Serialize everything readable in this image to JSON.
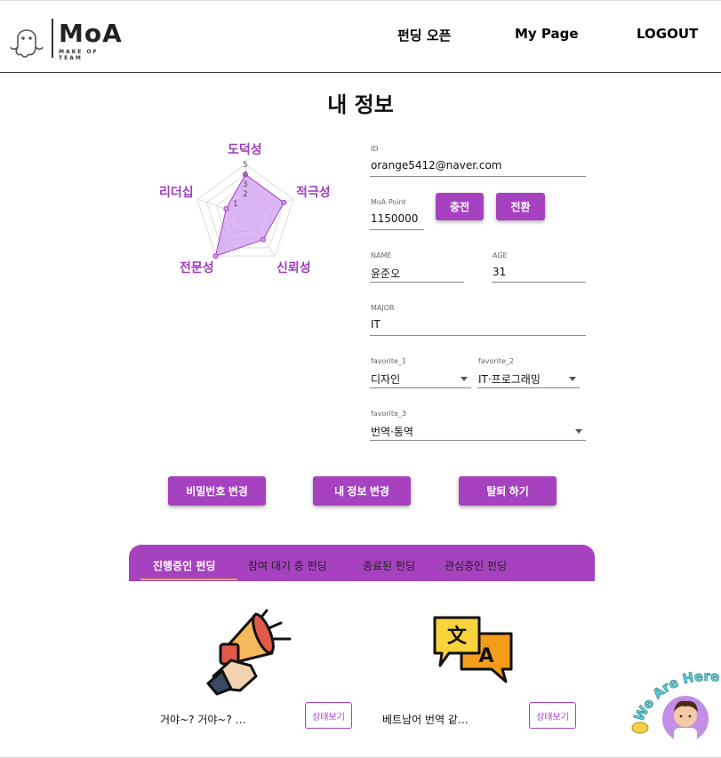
{
  "header": {
    "logo_text": "MoA",
    "logo_sub": "MAKE OF TEAM",
    "nav": [
      "펀딩 오픈",
      "My Page",
      "LOGOUT"
    ]
  },
  "page_title": "내 정보",
  "radar": {
    "labels": [
      "도덕성",
      "적극성",
      "신뢰성",
      "전문성",
      "리더십"
    ],
    "ticks": [
      "5",
      "4",
      "3",
      "2",
      "1"
    ],
    "values": [
      4,
      4,
      3,
      5,
      2
    ],
    "max": 5,
    "fill_color": "#cf9cf0",
    "line_color": "#a642bf"
  },
  "form": {
    "id": {
      "label": "ID",
      "value": "orange5412@naver.com"
    },
    "point": {
      "label": "MoA Point",
      "value": "1150000"
    },
    "name": {
      "label": "NAME",
      "value": "윤준오"
    },
    "age": {
      "label": "AGE",
      "value": "31"
    },
    "major": {
      "label": "MAJOR",
      "value": "IT"
    },
    "fav1": {
      "label": "favorite_1",
      "value": "디자인"
    },
    "fav2": {
      "label": "favorite_2",
      "value": "IT·프로그래밍"
    },
    "fav3": {
      "label": "favorite_3",
      "value": "번역·통역"
    }
  },
  "buttons": {
    "charge": "충전",
    "convert": "전환",
    "change_password": "비밀번호 변경",
    "change_info": "내 정보 변경",
    "withdraw": "탈퇴 하기"
  },
  "tabs": [
    "진행중인 펀딩",
    "참여 대기 중 펀딩",
    "종료된 펀딩",
    "관심중인 펀딩"
  ],
  "cards": [
    {
      "title": "거야~? 거야~? …",
      "status": "상태보기"
    },
    {
      "title": "베트남어 번역 같…",
      "status": "상태보기"
    }
  ],
  "badge_text": "We Are Here!",
  "colors": {
    "accent": "#a642bf",
    "tab_indicator": "#f0a33a"
  }
}
